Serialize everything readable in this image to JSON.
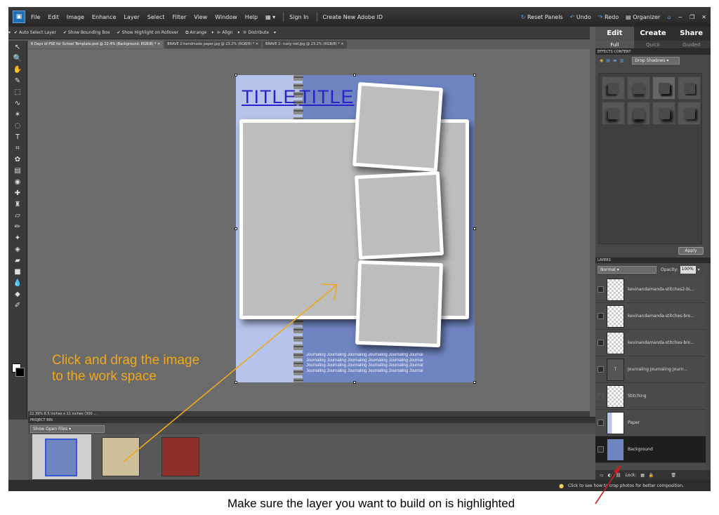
{
  "menubar": {
    "items": [
      "File",
      "Edit",
      "Image",
      "Enhance",
      "Layer",
      "Select",
      "Filter",
      "View",
      "Window",
      "Help"
    ],
    "sign_in": "Sign In",
    "create_id": "Create New Adobe ID",
    "reset_panels": "Reset Panels",
    "undo": "Undo",
    "redo": "Redo",
    "organizer": "Organizer"
  },
  "options_bar": {
    "auto_select": "Auto Select Layer",
    "bounding_box": "Show Bounding Box",
    "highlight": "Show Highlight on Rollover",
    "arrange": "Arrange",
    "align": "Align",
    "distribute": "Distribute"
  },
  "doc_tabs": [
    "6 Days of PSE for School Template.psd @ 22.4% (Background, RGB/8) *",
    "BRAVE 2-handmade paper.jpg @ 23.2% (RGB/8) *",
    "BRAVE 2- rusty red.jpg @ 23.2% (RGB/8) *"
  ],
  "document": {
    "title_1": "TITLE",
    "title_2": "TITLE",
    "journal_lines": [
      "Journaling  Journaling  Journaling  Journaling  Journaling Journal",
      "Journaling Journaling Journaling Journaling Journaling Journal",
      "Journaling  Journaling  Journaling  Journaling  Journaling Journal",
      "Journaling Journaling Journaling Journaling Journaling Journal"
    ]
  },
  "status": {
    "zoom": "22.39%",
    "size": "8.5 inches x 11 inches (300 ..."
  },
  "project_bin": {
    "header": "PROJECT BIN",
    "dropdown": "Show Open Files"
  },
  "right_panel": {
    "modes": [
      "Edit",
      "Create",
      "Share"
    ],
    "subtabs": [
      "Full",
      "Quick",
      "Guided"
    ],
    "effects_tabs": "EFFECTS  CONTENT",
    "effects_filter": "Drop Shadows",
    "apply": "Apply",
    "layers_header": "LAYERS",
    "blend_mode": "Normal",
    "opacity_label": "Opacity:",
    "opacity_value": "100%",
    "layers": [
      {
        "name": "kevinandamanda-stitches2-bi..."
      },
      {
        "name": "kevinandamanda-stitches-bro..."
      },
      {
        "name": "kevinandamanda-stitches-bro..."
      },
      {
        "name": "Journaling  Journaling  Journ..."
      },
      {
        "name": "Stitching"
      },
      {
        "name": "Paper"
      },
      {
        "name": "Background"
      }
    ],
    "lock_label": "Lock:"
  },
  "tip": "Click to see how to crop photos for better composition.",
  "annotations": {
    "drag_line1": "Click and drag the image",
    "drag_line2": "to the work space",
    "layer_note": "Make sure the layer you want to build on is highlighted"
  },
  "colors": {
    "annotation_orange": "#f0a81c",
    "annotation_red": "#c81e1e",
    "title_blue": "#2a22c8",
    "paper_blue": "#6f85c2"
  }
}
